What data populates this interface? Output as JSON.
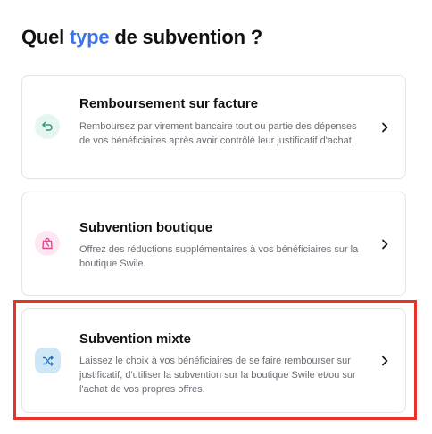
{
  "heading": {
    "before": "Quel ",
    "accent": "type",
    "after": " de subvention ?"
  },
  "options": [
    {
      "title": "Remboursement sur facture",
      "description": "Remboursez par virement bancaire tout ou partie des dépenses de vos bénéficiaires après avoir contrôlé leur justificatif d'achat.",
      "icon": "undo-arrow-icon",
      "icon_color": "#2e9b78",
      "icon_bg": "#e4f6ef"
    },
    {
      "title": "Subvention boutique",
      "description": "Offrez des réductions supplémentaires à vos bénéficiaires sur la boutique Swile.",
      "icon": "shopping-bag-icon",
      "icon_color": "#e0488f",
      "icon_bg": "#fde7f2"
    },
    {
      "title": "Subvention mixte",
      "description": "Laissez le choix à vos bénéficiaires de se faire rembourser sur justificatif, d'utiliser la subvention sur la boutique Swile et/ou sur l'achat de vos propres offres.",
      "icon": "shuffle-icon",
      "icon_color": "#1f6fb3",
      "icon_bg": "#cfe6f7",
      "highlighted": true
    }
  ],
  "colors": {
    "accent": "#3b74e6",
    "highlight_border": "#e8332b"
  }
}
